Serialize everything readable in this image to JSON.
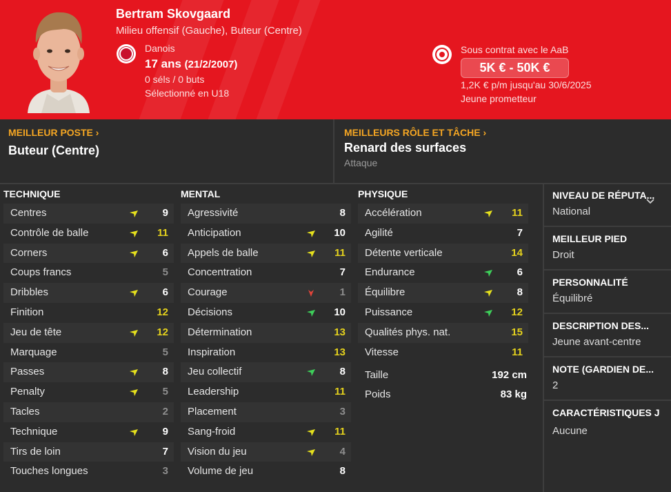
{
  "header": {
    "name": "Bertram Skovgaard",
    "positions": "Milieu offensif (Gauche), Buteur (Centre)",
    "nationality": "Danois",
    "age": "17 ans",
    "dob": "(21/2/2007)",
    "caps": "0 séls / 0 buts",
    "selected": "Sélectionné en U18",
    "contract": "Sous contrat avec le AaB",
    "value": "5K € - 50K €",
    "wage": "1,2K € p/m jusqu'au 30/6/2025",
    "potential": "Jeune prometteur",
    "colors": {
      "header_bg": "#e5161f",
      "accent": "#f5a623",
      "high_value": "#e5d21d"
    }
  },
  "best_position": {
    "title": "MEILLEUR POSTE",
    "value": "Buteur (Centre)"
  },
  "best_role": {
    "title": "MEILLEURS RÔLE ET TÂCHE",
    "value": "Renard des surfaces",
    "duty": "Attaque"
  },
  "technical": {
    "title": "TECHNIQUE",
    "attrs": [
      {
        "label": "Centres",
        "value": "9",
        "arrow": "up-yellow"
      },
      {
        "label": "Contrôle de balle",
        "value": "11",
        "arrow": "up-yellow"
      },
      {
        "label": "Corners",
        "value": "6",
        "arrow": "up-yellow"
      },
      {
        "label": "Coups francs",
        "value": "5",
        "arrow": ""
      },
      {
        "label": "Dribbles",
        "value": "6",
        "arrow": "up-yellow"
      },
      {
        "label": "Finition",
        "value": "12",
        "arrow": ""
      },
      {
        "label": "Jeu de tête",
        "value": "12",
        "arrow": "up-yellow"
      },
      {
        "label": "Marquage",
        "value": "5",
        "arrow": ""
      },
      {
        "label": "Passes",
        "value": "8",
        "arrow": "up-yellow"
      },
      {
        "label": "Penalty",
        "value": "5",
        "arrow": "up-yellow"
      },
      {
        "label": "Tacles",
        "value": "2",
        "arrow": ""
      },
      {
        "label": "Technique",
        "value": "9",
        "arrow": "up-yellow"
      },
      {
        "label": "Tirs de loin",
        "value": "7",
        "arrow": ""
      },
      {
        "label": "Touches longues",
        "value": "3",
        "arrow": ""
      }
    ]
  },
  "mental": {
    "title": "MENTAL",
    "attrs": [
      {
        "label": "Agressivité",
        "value": "8",
        "arrow": ""
      },
      {
        "label": "Anticipation",
        "value": "10",
        "arrow": "up-yellow"
      },
      {
        "label": "Appels de balle",
        "value": "11",
        "arrow": "up-yellow"
      },
      {
        "label": "Concentration",
        "value": "7",
        "arrow": ""
      },
      {
        "label": "Courage",
        "value": "1",
        "arrow": "down-red"
      },
      {
        "label": "Décisions",
        "value": "10",
        "arrow": "up-green"
      },
      {
        "label": "Détermination",
        "value": "13",
        "arrow": ""
      },
      {
        "label": "Inspiration",
        "value": "13",
        "arrow": ""
      },
      {
        "label": "Jeu collectif",
        "value": "8",
        "arrow": "up-green"
      },
      {
        "label": "Leadership",
        "value": "11",
        "arrow": ""
      },
      {
        "label": "Placement",
        "value": "3",
        "arrow": ""
      },
      {
        "label": "Sang-froid",
        "value": "11",
        "arrow": "up-yellow"
      },
      {
        "label": "Vision du jeu",
        "value": "4",
        "arrow": "up-yellow"
      },
      {
        "label": "Volume de jeu",
        "value": "8",
        "arrow": ""
      }
    ]
  },
  "physical": {
    "title": "PHYSIQUE",
    "attrs": [
      {
        "label": "Accélération",
        "value": "11",
        "arrow": "up-yellow"
      },
      {
        "label": "Agilité",
        "value": "7",
        "arrow": ""
      },
      {
        "label": "Détente verticale",
        "value": "14",
        "arrow": ""
      },
      {
        "label": "Endurance",
        "value": "6",
        "arrow": "up-green"
      },
      {
        "label": "Équilibre",
        "value": "8",
        "arrow": "up-yellow"
      },
      {
        "label": "Puissance",
        "value": "12",
        "arrow": "up-green"
      },
      {
        "label": "Qualités phys. nat.",
        "value": "15",
        "arrow": ""
      },
      {
        "label": "Vitesse",
        "value": "11",
        "arrow": ""
      }
    ],
    "height_label": "Taille",
    "height": "192 cm",
    "weight_label": "Poids",
    "weight": "83 kg"
  },
  "sidebar": [
    {
      "title": "NIVEAU DE RÉPUTA...",
      "value": "National"
    },
    {
      "title": "MEILLEUR PIED",
      "value": "Droit"
    },
    {
      "title": "PERSONNALITÉ",
      "value": "Équilibré"
    },
    {
      "title": "DESCRIPTION DES...",
      "value": "Jeune avant-centre"
    },
    {
      "title": "NOTE (GARDIEN DE...",
      "value": "2"
    },
    {
      "title": "CARACTÉRISTIQUES J",
      "value": "Aucune"
    }
  ]
}
